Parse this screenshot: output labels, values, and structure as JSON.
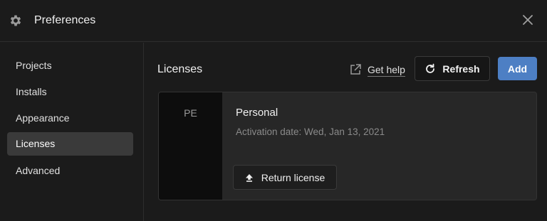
{
  "window": {
    "title": "Preferences",
    "icon": "gear-icon",
    "close_icon": "close-icon"
  },
  "sidebar": {
    "items": [
      {
        "label": "Projects",
        "active": false
      },
      {
        "label": "Installs",
        "active": false
      },
      {
        "label": "Appearance",
        "active": false
      },
      {
        "label": "Licenses",
        "active": true
      },
      {
        "label": "Advanced",
        "active": false
      }
    ]
  },
  "main": {
    "title": "Licenses",
    "get_help_label": "Get help",
    "get_help_icon": "external-link-icon",
    "refresh_label": "Refresh",
    "refresh_icon": "refresh-icon",
    "add_label": "Add"
  },
  "license_card": {
    "abbreviation": "PE",
    "name": "Personal",
    "activation_text": "Activation date: Wed, Jan 13, 2021",
    "return_label": "Return license",
    "return_icon": "upload-arrow-icon"
  },
  "colors": {
    "background": "#1b1b1b",
    "accent": "#4d7fc4",
    "active_item": "#3a3a3a",
    "card": "#272727"
  }
}
